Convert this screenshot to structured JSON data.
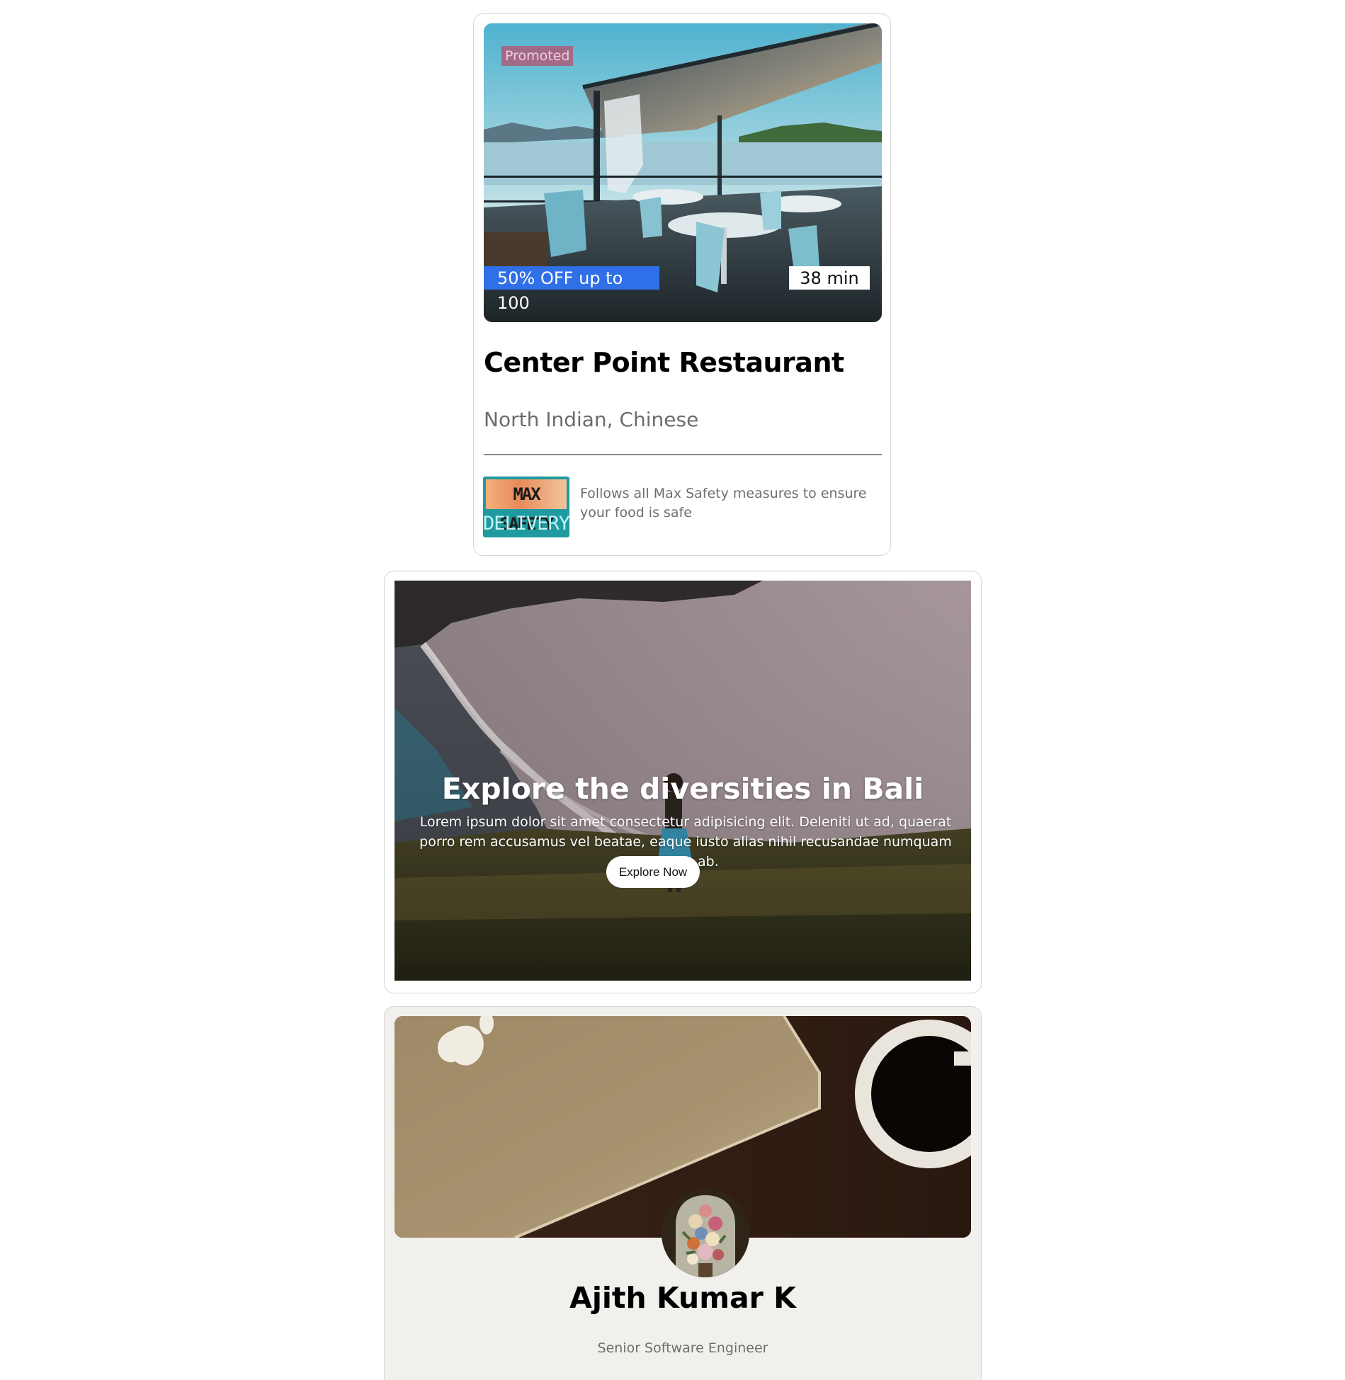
{
  "restaurant_card": {
    "promoted_label": "Promoted",
    "discount": "50% OFF up to 100",
    "delivery_time": "38 min",
    "name": "Center Point Restaurant",
    "cuisine": "North Indian, Chinese",
    "safety_badge": {
      "line1": "MAX SAFETY",
      "line2": "DELIVERY"
    },
    "safety_note": "Follows all Max Safety measures to ensure your food is safe",
    "colors": {
      "discount_bg": "#2f6fe8",
      "promoted_bg": "#b6506e"
    }
  },
  "explore_card": {
    "title": "Explore the diversities in Bali",
    "description": "Lorem ipsum dolor sit amet consectetur adipisicing elit. Deleniti ut ad, quaerat porro rem accusamus vel beatae, eaque iusto alias nihil recusandae numquam minus ab.",
    "button_label": "Explore Now"
  },
  "profile_card": {
    "name": "Ajith Kumar K",
    "role": "Senior Software Engineer",
    "colors": {
      "card_bg": "#f2f0ed"
    }
  }
}
